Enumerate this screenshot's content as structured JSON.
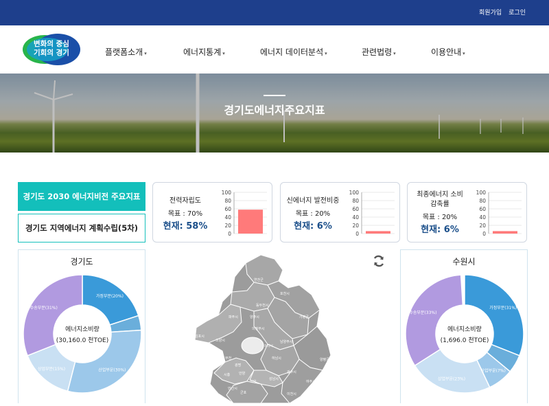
{
  "topbar": {
    "signup": "회원가입",
    "login": "로그인"
  },
  "logo": {
    "line1": "변화의 중심",
    "line2": "기회의 경기"
  },
  "nav": [
    {
      "label": "플랫폼소개"
    },
    {
      "label": "에너지통계"
    },
    {
      "label": "에너지 데이터분석"
    },
    {
      "label": "관련법령"
    },
    {
      "label": "이용안내"
    }
  ],
  "hero": {
    "title": "경기도에너지주요지표"
  },
  "left_buttons": {
    "vision": "경기도 2030 에너지비전 주요지표",
    "plan": "경기도 지역에너지 계획수립(5차)"
  },
  "indicators": [
    {
      "name_lines": [
        "전력자립도"
      ],
      "target": "목표 : 70%",
      "current": "현재: 58%",
      "value": 58
    },
    {
      "name_lines": [
        "신에너지 발전비중"
      ],
      "target": "목표 : 20%",
      "current": "현재: 6%",
      "value": 6
    },
    {
      "name_lines": [
        "최종에너지 소비",
        "감축률"
      ],
      "target": "목표 : 20%",
      "current": "현재: 6%",
      "value": 6
    }
  ],
  "indicator_axis": {
    "ticks": [
      "100",
      "80",
      "60",
      "40",
      "20",
      "0"
    ],
    "max": 100
  },
  "pies": [
    {
      "region": "경기도",
      "center_label": "에너지소비량",
      "center_value": "(30,160.0 천TOE)",
      "slices": [
        {
          "label": "가정부문(20%)",
          "pct": 20,
          "color": "#3a9ad9"
        },
        {
          "label": "",
          "pct": 4,
          "color": "#6aaedb"
        },
        {
          "label": "산업부문(30%)",
          "pct": 30,
          "color": "#9cc8ea"
        },
        {
          "label": "상업부문(15%)",
          "pct": 15,
          "color": "#c9e0f3"
        },
        {
          "label": "수송부문(31%)",
          "pct": 31,
          "color": "#b19ae0"
        }
      ]
    },
    {
      "region": "수원시",
      "center_label": "에너지소비량",
      "center_value": "(1,696.0 천TOE)",
      "slices": [
        {
          "label": "가정부문(31%)",
          "pct": 31,
          "color": "#3a9ad9"
        },
        {
          "label": "",
          "pct": 5,
          "color": "#6aaedb"
        },
        {
          "label": "산업부문(7%)",
          "pct": 7,
          "color": "#9cc8ea"
        },
        {
          "label": "상업부문(23%)",
          "pct": 23,
          "color": "#c9e0f3"
        },
        {
          "label": "수송부문(33%)",
          "pct": 33,
          "color": "#b19ae0"
        }
      ]
    }
  ],
  "map_labels": [
    "연천군",
    "포천시",
    "동두천시",
    "파주시",
    "양주시",
    "의정부시",
    "가평군",
    "고양시",
    "남양주시",
    "구리시",
    "김포시",
    "하남시",
    "양평군",
    "부천",
    "광명",
    "시흥",
    "안양",
    "성남시",
    "광주시",
    "안산시",
    "의왕",
    "군포",
    "여주시",
    "이천시"
  ],
  "colors": {
    "topbar": "#1e3f8c",
    "accent": "#13bfbb",
    "bar": "#ff7a7a",
    "current_text": "#1b4f8a"
  }
}
